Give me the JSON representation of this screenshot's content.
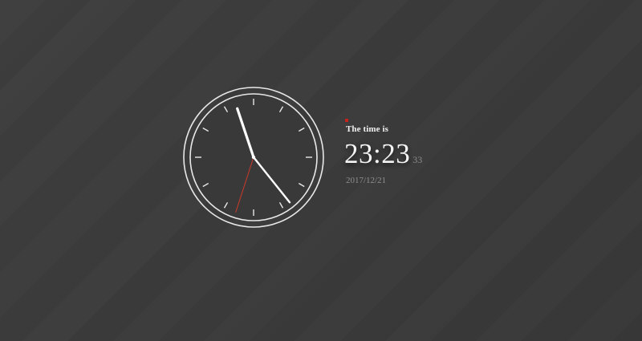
{
  "clock": {
    "hour_hand_time": "23:23",
    "minute_value": 23,
    "second_value": 33,
    "hand_colors": {
      "hour": "#ffffff",
      "minute": "#ffffff",
      "second": "#c0392b"
    },
    "face_color": "#393939",
    "ring_color": "#e8e8e8"
  },
  "readout": {
    "label": "The time is",
    "hours_minutes": "23:23",
    "seconds": "33",
    "date": "2017/12/21",
    "marker_color": "#d0201c"
  }
}
